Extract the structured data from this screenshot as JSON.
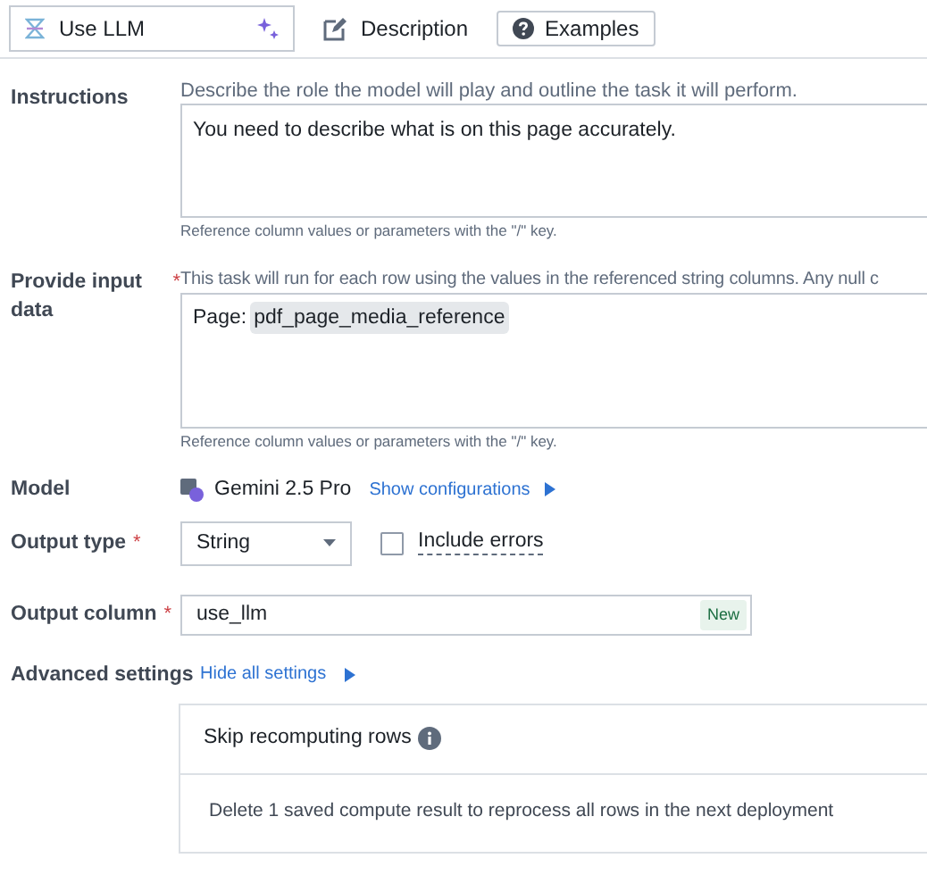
{
  "header": {
    "name_field": {
      "value": "Use LLM"
    },
    "description_button": "Description",
    "examples_button": "Examples"
  },
  "instructions": {
    "label": "Instructions",
    "hint": "Describe the role the model will play and outline the task it will perform.",
    "value": "You need to describe what is on this page accurately.",
    "footnote": "Reference column values or parameters with the \"/\" key."
  },
  "input_data": {
    "label": "Provide input data",
    "required_mark": "*",
    "hint": "This task will run for each row using the values in the referenced string columns. Any null c",
    "prefix": "Page:",
    "chip": "pdf_page_media_reference",
    "footnote": "Reference column values or parameters with the \"/\" key."
  },
  "model": {
    "label": "Model",
    "value": "Gemini 2.5 Pro",
    "link": "Show configurations"
  },
  "output_type": {
    "label": "Output type",
    "required_mark": "*",
    "value": "String",
    "checkbox": {
      "label": "Include errors",
      "checked": false
    }
  },
  "output_column": {
    "label": "Output column",
    "required_mark": "*",
    "value": "use_llm",
    "badge": "New"
  },
  "advanced": {
    "label": "Advanced settings",
    "link": "Hide all settings",
    "panel": {
      "title": "Skip recomputing rows",
      "text": "Delete 1 saved compute result to reprocess all rows in the next deployment"
    }
  }
}
